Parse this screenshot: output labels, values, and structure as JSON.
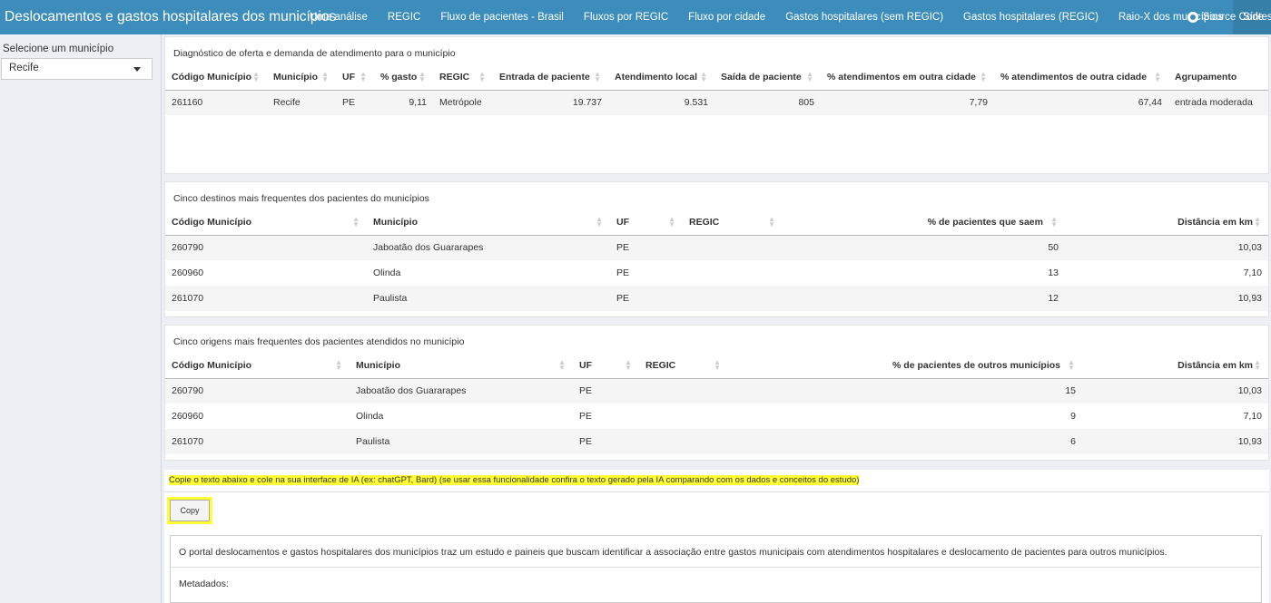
{
  "app": {
    "title": "Deslocamentos e gastos hospitalares dos municípios",
    "tabs": [
      "Uma análise",
      "REGIC",
      "Fluxo de pacientes - Brasil",
      "Fluxos por REGIC",
      "Fluxo por cidade",
      "Gastos hospitalares (sem REGIC)",
      "Gastos hospitalares (REGIC)",
      "Raio-X dos municípios",
      "Síntese"
    ],
    "active_tab": "Síntese",
    "source_label": "Source Code"
  },
  "sidebar": {
    "label": "Selecione um município",
    "selected": "Recife"
  },
  "panel1": {
    "title": "Diagnóstico de oferta e demanda de atendimento para o município",
    "headers": [
      "Código Município",
      "Município",
      "UF",
      "% gasto",
      "REGIC",
      "Entrada de paciente",
      "Atendimento local",
      "Saída de paciente",
      "% atendimentos em outra cidade",
      "% atendimentos de outra cidade",
      "Agrupamento"
    ],
    "rows": [
      [
        "261160",
        "Recife",
        "PE",
        "9,11",
        "Metrópole",
        "19.737",
        "9.531",
        "805",
        "7,79",
        "67,44",
        "entrada moderada"
      ]
    ]
  },
  "panel2": {
    "title": "Cinco destinos mais frequentes dos pacientes do municípios",
    "headers": [
      "Código Município",
      "Município",
      "UF",
      "REGIC",
      "% de pacientes que saem",
      "Distância em km"
    ],
    "rows": [
      [
        "260790",
        "Jaboatão dos Guararapes",
        "PE",
        "",
        "50",
        "10,03"
      ],
      [
        "260960",
        "Olinda",
        "PE",
        "",
        "13",
        "7,10"
      ],
      [
        "261070",
        "Paulista",
        "PE",
        "",
        "12",
        "10,93"
      ]
    ]
  },
  "panel3": {
    "title": "Cinco origens mais frequentes dos pacientes atendidos no município",
    "headers": [
      "Código Município",
      "Município",
      "UF",
      "REGIC",
      "% de pacientes de outros municípios",
      "Distância em km"
    ],
    "rows": [
      [
        "260790",
        "Jaboatão dos Guararapes",
        "PE",
        "",
        "15",
        "10,03"
      ],
      [
        "260960",
        "Olinda",
        "PE",
        "",
        "9",
        "7,10"
      ],
      [
        "261070",
        "Paulista",
        "PE",
        "",
        "6",
        "10,93"
      ]
    ]
  },
  "copy": {
    "instruction": "Copie o texto abaixo e cole na sua interface de IA (ex: chatGPT, Bard) (se usar essa funcionalidade confira o texto gerado pela IA comparando com os dados e conceitos do estudo)",
    "button": "Copy",
    "text1": "O portal deslocamentos e gastos hospitalares dos municípios traz um estudo e paineis que buscam identificar a associação entre gastos municipais com atendimentos hospitalares e deslocamento de pacientes para outros municípios.",
    "text2": "Metadados:"
  }
}
